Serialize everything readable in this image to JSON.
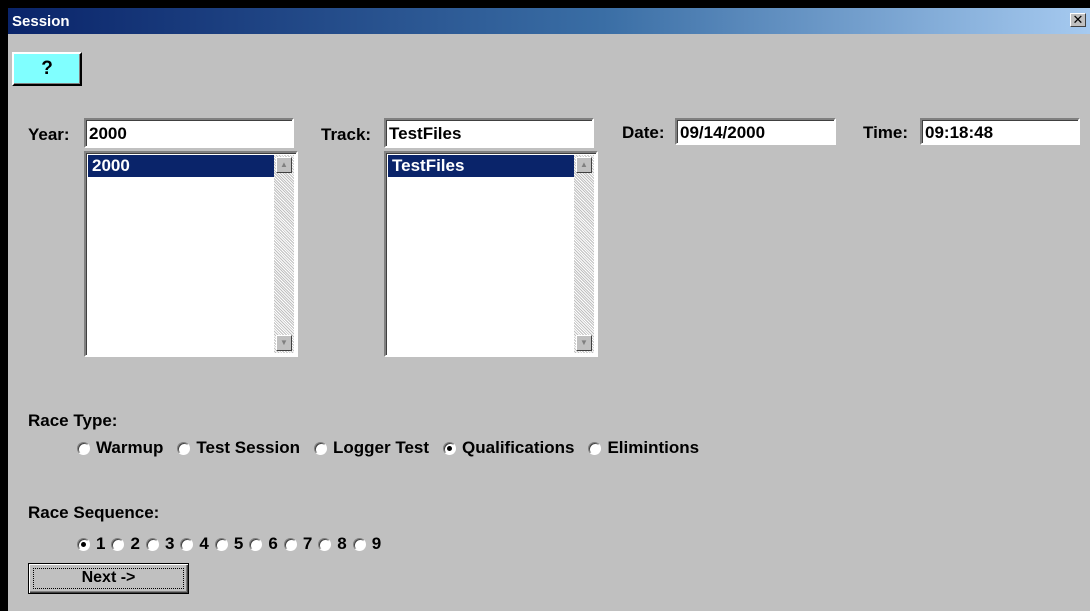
{
  "window": {
    "title": "Session",
    "close_glyph": "✕"
  },
  "help_button": {
    "icon": "question-mark-icon",
    "glyph": "?"
  },
  "year": {
    "label": "Year:",
    "value": "2000",
    "list": [
      "2000"
    ]
  },
  "track": {
    "label": "Track:",
    "value": "TestFiles",
    "list": [
      "TestFiles"
    ]
  },
  "date": {
    "label": "Date:",
    "value": "09/14/2000"
  },
  "time": {
    "label": "Time:",
    "value": "09:18:48"
  },
  "race_type": {
    "label": "Race Type:",
    "options": [
      "Warmup",
      "Test Session",
      "Logger Test",
      "Qualifications",
      "Elimintions"
    ],
    "selected": "Qualifications"
  },
  "race_sequence": {
    "label": "Race Sequence:",
    "options": [
      "1",
      "2",
      "3",
      "4",
      "5",
      "6",
      "7",
      "8",
      "9"
    ],
    "selected": "1"
  },
  "next_button": {
    "label": "Next ->"
  },
  "colors": {
    "title_bar": "#0a246a",
    "dialog_bg": "#c0c0c0",
    "help_button_bg": "#80ffff",
    "selection": "#0a246a"
  }
}
